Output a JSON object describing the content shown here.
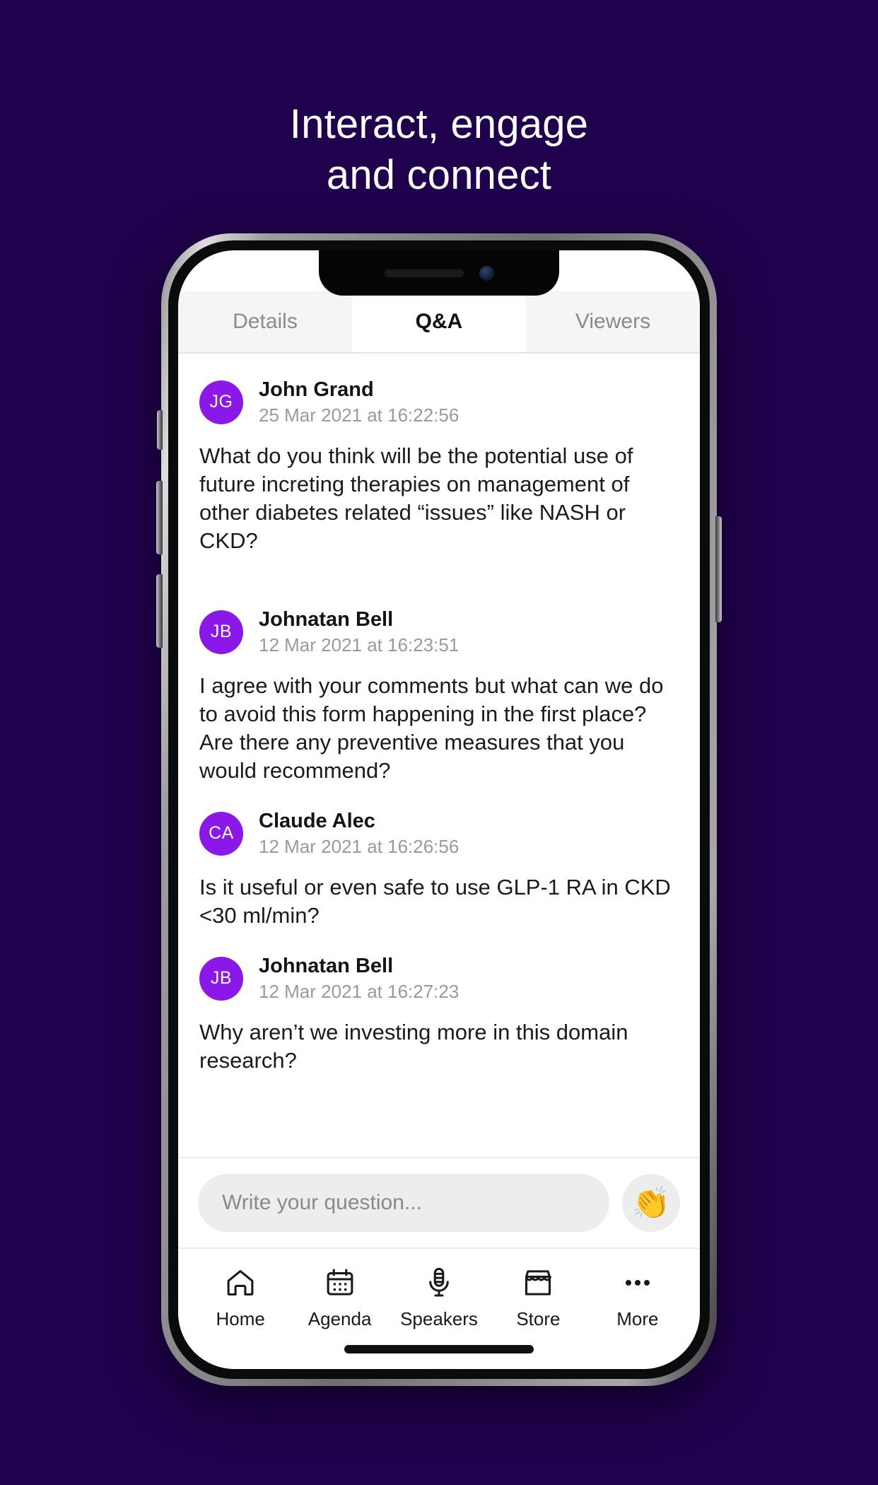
{
  "headline": {
    "line1": "Interact, engage",
    "line2": "and connect"
  },
  "colors": {
    "background": "#20014D",
    "avatar": "#8B17E8",
    "tab_active_bg": "#FFFFFF",
    "tab_inactive_bg": "#F5F5F5",
    "tab_inactive_text": "#8B8B8B",
    "composer_bg": "#EDEDED"
  },
  "tabs": [
    {
      "label": "Details",
      "active": false
    },
    {
      "label": "Q&A",
      "active": true
    },
    {
      "label": "Viewers",
      "active": false
    }
  ],
  "qa": {
    "items": [
      {
        "initials": "JG",
        "author": "John Grand",
        "timestamp": "25 Mar 2021 at 16:22:56",
        "text": "What do you think will be the potential use of future increting therapies on management of other diabetes related “issues” like NASH or CKD?"
      },
      {
        "initials": "JB",
        "author": "Johnatan Bell",
        "timestamp": "12 Mar 2021 at 16:23:51",
        "text": "I agree with your comments but what can we do to avoid this form happening in the first place? Are there any preventive measures that you would recommend?"
      },
      {
        "initials": "CA",
        "author": "Claude Alec",
        "timestamp": "12 Mar 2021 at 16:26:56",
        "text": "Is it useful or even safe to use GLP-1 RA in CKD <30 ml/min?"
      },
      {
        "initials": "JB",
        "author": "Johnatan Bell",
        "timestamp": "12 Mar 2021 at 16:27:23",
        "text": "Why aren’t we investing more in this domain research?"
      }
    ]
  },
  "composer": {
    "placeholder": "Write your question...",
    "clap_icon": "clapping-hands-emoji",
    "clap_glyph": "👏"
  },
  "bottom_nav": [
    {
      "label": "Home",
      "icon": "home-icon"
    },
    {
      "label": "Agenda",
      "icon": "calendar-icon"
    },
    {
      "label": "Speakers",
      "icon": "microphone-icon"
    },
    {
      "label": "Store",
      "icon": "storefront-icon"
    },
    {
      "label": "More",
      "icon": "ellipsis-icon"
    }
  ]
}
